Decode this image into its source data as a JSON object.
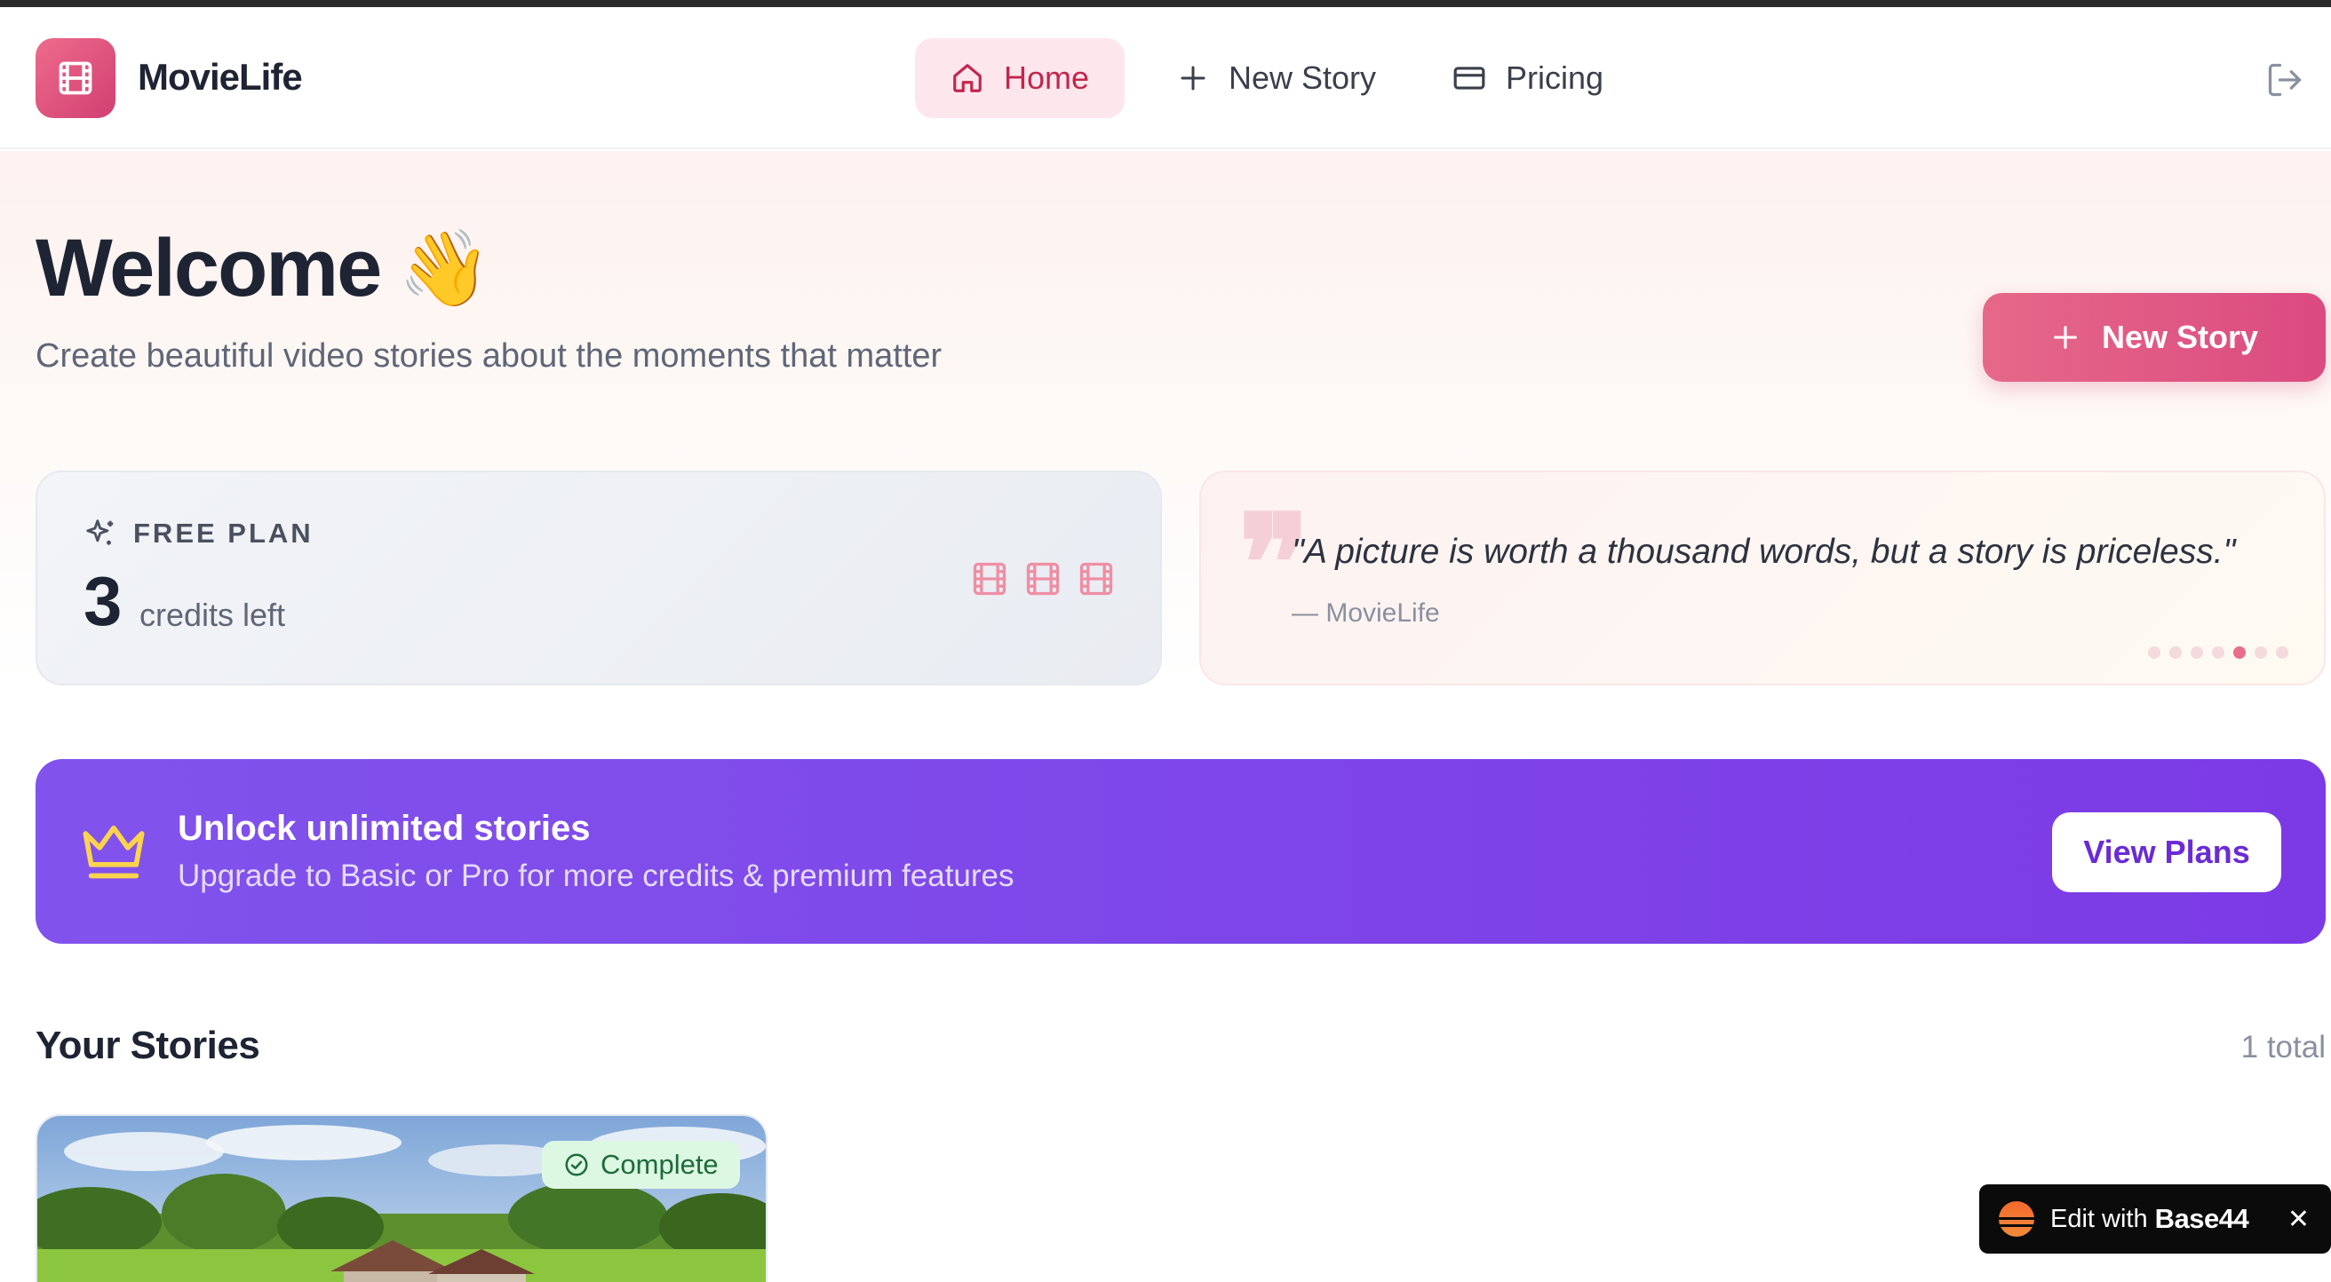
{
  "app": {
    "name": "MovieLife"
  },
  "nav": {
    "home": "Home",
    "new_story": "New Story",
    "pricing": "Pricing"
  },
  "hero": {
    "title": "Welcome",
    "emoji": "👋",
    "subtitle": "Create beautiful video stories about the moments that matter",
    "button": "New Story"
  },
  "plan": {
    "label": "FREE PLAN",
    "credits": "3",
    "credits_text": "credits left",
    "film_icons": 3
  },
  "quote": {
    "text": "\"A picture is worth a thousand words, but a story is priceless.\"",
    "author": "— MovieLife",
    "dots_total": 7,
    "dot_active_index": 4
  },
  "banner": {
    "title": "Unlock unlimited stories",
    "subtitle": "Upgrade to Basic or Pro for more credits & premium features",
    "button": "View Plans"
  },
  "stories": {
    "title": "Your Stories",
    "total": "1 total",
    "items": [
      {
        "status": "Complete"
      }
    ]
  },
  "edit_widget": {
    "text": "Edit with",
    "brand": "Base44",
    "close": "✕"
  },
  "colors": {
    "accent": "#db4a80",
    "purple": "#7c3ae6",
    "success_bg": "#dcf7e2"
  }
}
